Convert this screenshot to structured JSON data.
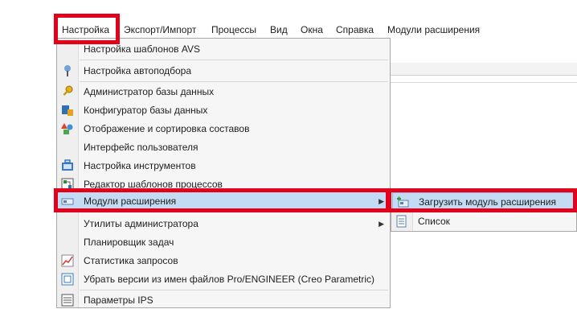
{
  "menubar": {
    "items": [
      "Настройка",
      "Экспорт/Импорт",
      "Процессы",
      "Вид",
      "Окна",
      "Справка",
      "Модули расширения"
    ]
  },
  "settings_menu": {
    "items": [
      {
        "label": "Настройка шаблонов AVS",
        "icon": "none"
      },
      {
        "label": "Настройка автоподбора",
        "icon": "tree-icon"
      },
      {
        "label": "Администратор базы данных",
        "icon": "key-icon"
      },
      {
        "label": "Конфигуратор базы данных",
        "icon": "db-config-icon"
      },
      {
        "label": "Отображение и сортировка составов",
        "icon": "shapes-icon"
      },
      {
        "label": "Интерфейс пользователя",
        "icon": "none"
      },
      {
        "label": "Настройка инструментов",
        "icon": "toolbox-icon"
      },
      {
        "label": "Редактор шаблонов процессов",
        "icon": "template-icon"
      },
      {
        "label": "Модули расширения",
        "icon": "module-icon",
        "has_submenu": true,
        "active": true
      },
      {
        "label": "Утилиты администратора",
        "icon": "none",
        "has_submenu": true
      },
      {
        "label": "Планировщик задач",
        "icon": "none"
      },
      {
        "label": "Статистика запросов",
        "icon": "stats-icon"
      },
      {
        "label": "Убрать версии из имен файлов Pro/ENGINEER (Creo Parametric)",
        "icon": "strip-version-icon"
      },
      {
        "label": "Параметры IPS",
        "icon": "params-icon"
      }
    ]
  },
  "extensions_submenu": {
    "items": [
      {
        "label": "Загрузить модуль расширения",
        "icon": "load-module-icon",
        "active": true
      },
      {
        "label": "Список",
        "icon": "list-icon"
      }
    ]
  },
  "colors": {
    "highlight_box": "#e3001b",
    "active_row": "#c4dcf3"
  }
}
